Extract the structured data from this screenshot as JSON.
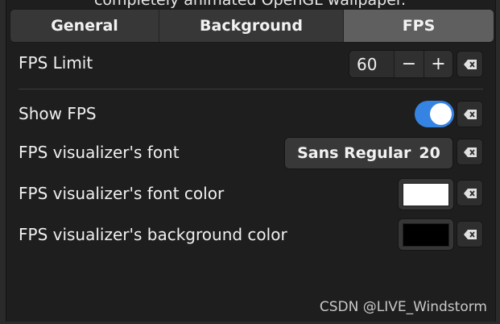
{
  "window": {
    "header_text": "completely animated OpenGL wallpaper."
  },
  "tabs": [
    {
      "label": "General",
      "active": false
    },
    {
      "label": "Background",
      "active": false
    },
    {
      "label": "FPS",
      "active": true
    }
  ],
  "settings": {
    "fps_limit": {
      "label": "FPS Limit",
      "value": "60",
      "decrement": "−",
      "increment": "+"
    },
    "show_fps": {
      "label": "Show FPS",
      "enabled": true
    },
    "font": {
      "label": "FPS visualizer's font",
      "font_name": "Sans Regular",
      "font_size": "20"
    },
    "font_color": {
      "label": "FPS visualizer's font color",
      "color": "#ffffff"
    },
    "background_color": {
      "label": "FPS visualizer's background color",
      "color": "#000000"
    }
  },
  "icons": {
    "reset": "clear-icon"
  },
  "colors": {
    "accent": "#3584e4",
    "active_tab": "#5f5f5f"
  },
  "watermark": "CSDN @LIVE_Windstorm"
}
